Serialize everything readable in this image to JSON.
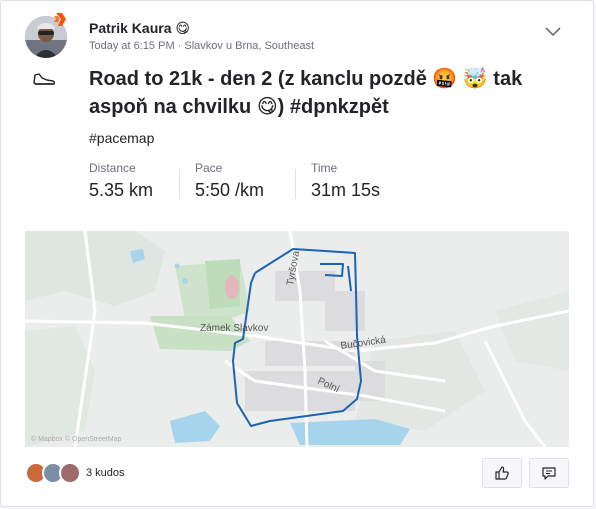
{
  "activity": {
    "athlete_name": "Patrik Kaura 😋",
    "timestamp": "Today at 6:15 PM · Slavkov u Brna, Southeast",
    "title": "Road to 21k - den 2 (z kanclu pozdě 🤬 🤯 tak aspoň na chvilku 😋) #dpnkzpět",
    "hashtag": "#pacemap",
    "stats": [
      {
        "label": "Distance",
        "value": "5.35 km"
      },
      {
        "label": "Pace",
        "value": "5:50 /km"
      },
      {
        "label": "Time",
        "value": "31m 15s"
      }
    ]
  },
  "map": {
    "labels": {
      "castle": "Zámek Slavkov",
      "street_tyrsova": "Tyršova",
      "street_bucovicka": "Bučovická",
      "street_polni": "Polní",
      "copyright": "© Mapbox © OpenStreetMap"
    },
    "route_color": "#1c64b2"
  },
  "social": {
    "kudos_text": "3 kudos"
  },
  "colors": {
    "brand": "#fc5200",
    "text": "#242428",
    "muted": "#6d6d78"
  }
}
